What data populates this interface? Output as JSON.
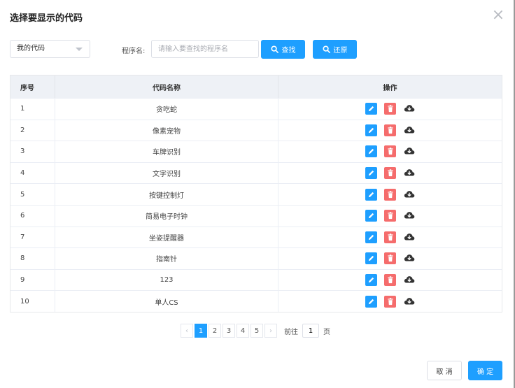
{
  "dialog": {
    "title": "选择要显示的代码",
    "close_glyph": "×"
  },
  "filter": {
    "select_value": "我的代码",
    "program_label": "程序名:",
    "search_placeholder": "请输入要查找的程序名",
    "search_value": "",
    "find_label": "查找",
    "reset_label": "还原"
  },
  "table": {
    "headers": {
      "index": "序号",
      "name": "代码名称",
      "ops": "操作"
    },
    "rows": [
      {
        "index": "1",
        "name": "贪吃蛇"
      },
      {
        "index": "2",
        "name": "像素宠物"
      },
      {
        "index": "3",
        "name": "车牌识别"
      },
      {
        "index": "4",
        "name": "文字识别"
      },
      {
        "index": "5",
        "name": "按键控制灯"
      },
      {
        "index": "6",
        "name": "简易电子时钟"
      },
      {
        "index": "7",
        "name": "坐姿提醒器"
      },
      {
        "index": "8",
        "name": "指南针"
      },
      {
        "index": "9",
        "name": "123"
      },
      {
        "index": "10",
        "name": "单人CS"
      }
    ]
  },
  "icons": {
    "edit": "edit-icon",
    "delete": "trash-icon",
    "download": "cloud-download-icon",
    "search": "search-icon"
  },
  "pagination": {
    "prev": "‹",
    "next": "›",
    "pages": [
      "1",
      "2",
      "3",
      "4",
      "5"
    ],
    "current": "1",
    "goto_prefix": "前往",
    "goto_value": "1",
    "goto_suffix": "页"
  },
  "footer": {
    "cancel_label": "取 消",
    "ok_label": "确 定"
  },
  "colors": {
    "primary": "#1e9fff",
    "danger": "#f56c6c",
    "header_bg": "#eef1f6"
  }
}
